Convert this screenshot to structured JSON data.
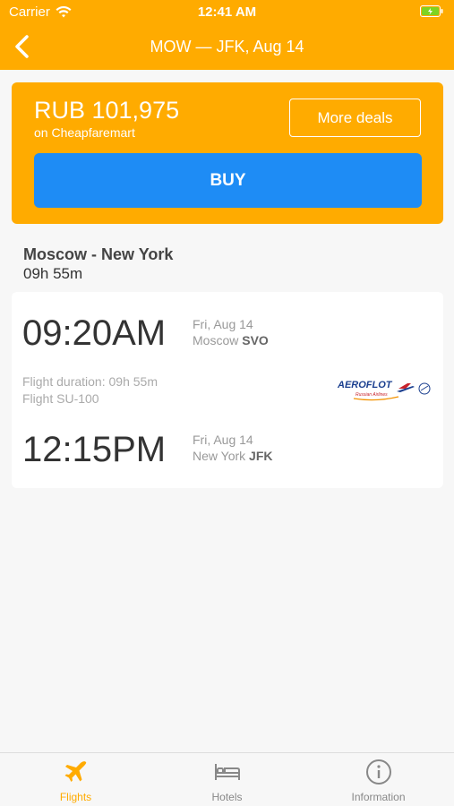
{
  "status": {
    "carrier": "Carrier",
    "time": "12:41 AM"
  },
  "nav": {
    "title": "MOW — JFK, Aug 14"
  },
  "offer": {
    "price": "RUB 101,975",
    "source": "on Cheapfaremart",
    "more_deals_label": "More deals",
    "buy_label": "BUY"
  },
  "route": {
    "title": "Moscow - New York",
    "duration": "09h 55m"
  },
  "flight": {
    "departure": {
      "time": "09:20AM",
      "date": "Fri, Aug 14",
      "city": "Moscow",
      "airport": "SVO"
    },
    "duration_text": "Flight duration: 09h 55m",
    "flight_number": "Flight SU-100",
    "airline": {
      "name": "AEROFLOT",
      "tagline": "Russian Airlines"
    },
    "arrival": {
      "time": "12:15PM",
      "date": "Fri, Aug 14",
      "city": "New York",
      "airport": "JFK"
    }
  },
  "tabs": [
    {
      "label": "Flights",
      "icon": "plane-icon",
      "active": true
    },
    {
      "label": "Hotels",
      "icon": "bed-icon",
      "active": false
    },
    {
      "label": "Information",
      "icon": "info-icon",
      "active": false
    }
  ],
  "colors": {
    "accent": "#ffab00",
    "buy": "#1e8cf5"
  }
}
